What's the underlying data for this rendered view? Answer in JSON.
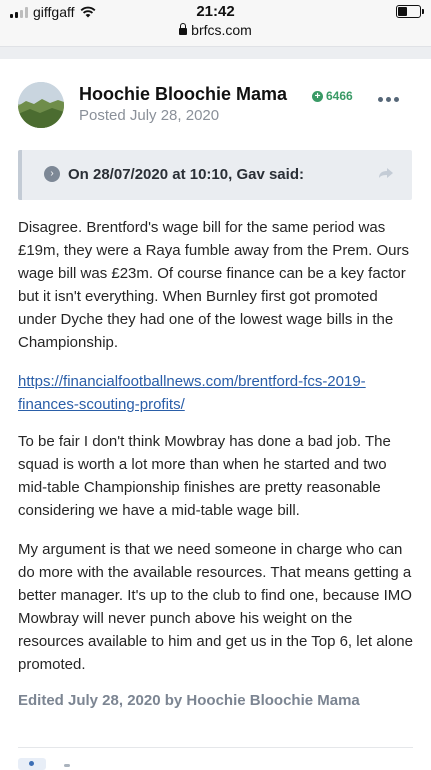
{
  "status_bar": {
    "carrier": "giffgaff",
    "time": "21:42",
    "url": "brfcs.com"
  },
  "post": {
    "author": "Hoochie Bloochie Mama",
    "reputation": "6466",
    "posted": "Posted July 28, 2020",
    "quote": {
      "cite": "On 28/07/2020 at 10:10, Gav said:"
    },
    "paragraphs": [
      "Disagree. Brentford's wage bill for the same period was £19m, they were a Raya fumble away from the Prem. Ours wage bill was £23m. Of course finance can be a key factor but it isn't everything. When Burnley first got promoted under Dyche they had one of the lowest wage bills in the Championship.",
      "To be fair I don't think Mowbray has done a bad job. The squad is worth a lot more than when he started and two mid-table Championship finishes are pretty reasonable considering we have a mid-table wage bill.",
      "My argument is that we need someone in charge who can do more with the available resources. That means getting a better manager. It's up to the club to find one, because IMO Mowbray will never punch above his weight on the resources available to him and get us in the Top 6, let alone promoted."
    ],
    "link": "https://financialfootballnews.com/brentford-fcs-2019-finances-scouting-profits/",
    "edited": "Edited July 28, 2020 by Hoochie Bloochie Mama"
  },
  "colors": {
    "accent_link": "#2a5ea8",
    "reputation_green": "#3a9a66",
    "quote_bg": "#eaedf1"
  },
  "icons": [
    "signal-icon",
    "wifi-icon",
    "lock-icon",
    "battery-icon",
    "reputation-plus-icon",
    "more-options-icon",
    "quote-expand-icon",
    "share-icon"
  ]
}
